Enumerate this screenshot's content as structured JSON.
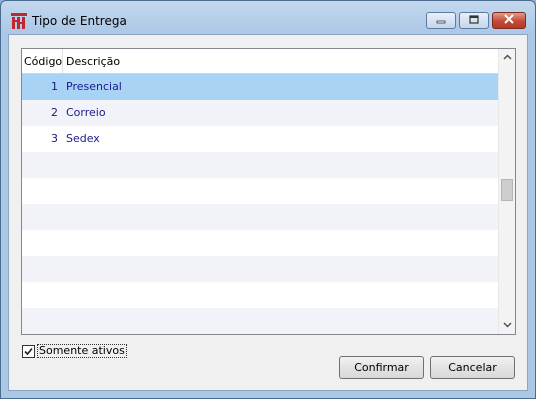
{
  "window": {
    "title": "Tipo de Entrega",
    "icon": "app-logo-icon",
    "controls": [
      "minimize-icon",
      "maximize-icon",
      "close-icon"
    ],
    "accent_color": "#a9d3f5"
  },
  "grid": {
    "columns": [
      "Código",
      "Descrição"
    ],
    "rows": [
      {
        "code": "1",
        "description": "Presencial",
        "selected": true
      },
      {
        "code": "2",
        "description": "Correio",
        "selected": false
      },
      {
        "code": "3",
        "description": "Sedex",
        "selected": false
      },
      {
        "code": "",
        "description": ""
      },
      {
        "code": "",
        "description": ""
      },
      {
        "code": "",
        "description": ""
      },
      {
        "code": "",
        "description": ""
      },
      {
        "code": "",
        "description": ""
      },
      {
        "code": "",
        "description": ""
      },
      {
        "code": "",
        "description": ""
      }
    ]
  },
  "filter": {
    "label": "Somente ativos",
    "checked": true
  },
  "buttons": {
    "confirm": "Confirmar",
    "cancel": "Cancelar"
  }
}
